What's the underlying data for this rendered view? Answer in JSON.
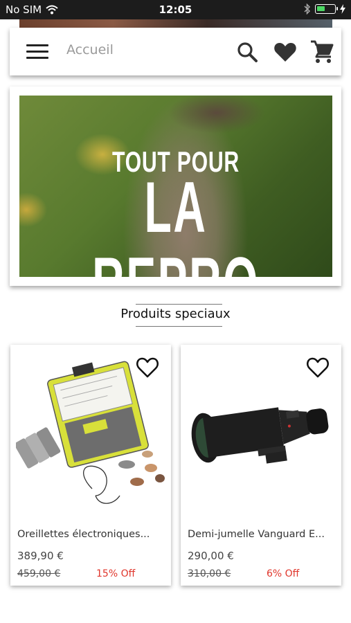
{
  "status_bar": {
    "carrier": "No SIM",
    "time": "12:05"
  },
  "header": {
    "title": "Accueil",
    "icons": [
      "menu-icon",
      "search-icon",
      "heart-icon",
      "cart-icon"
    ]
  },
  "banner": {
    "line1": "TOUT POUR",
    "line2": "LA REPRO"
  },
  "section": {
    "title": "Produits speciaux"
  },
  "products": [
    {
      "name": "Oreillettes électroniques...",
      "price": "389,90 €",
      "old_price": "459,00 €",
      "discount": "15% Off"
    },
    {
      "name": "Demi-jumelle Vanguard E...",
      "price": "290,00 €",
      "old_price": "310,00 €",
      "discount": "6% Off"
    }
  ],
  "colors": {
    "discount": "#e0352b",
    "status_bar": "#1c1c1c",
    "battery": "#4cd964"
  }
}
